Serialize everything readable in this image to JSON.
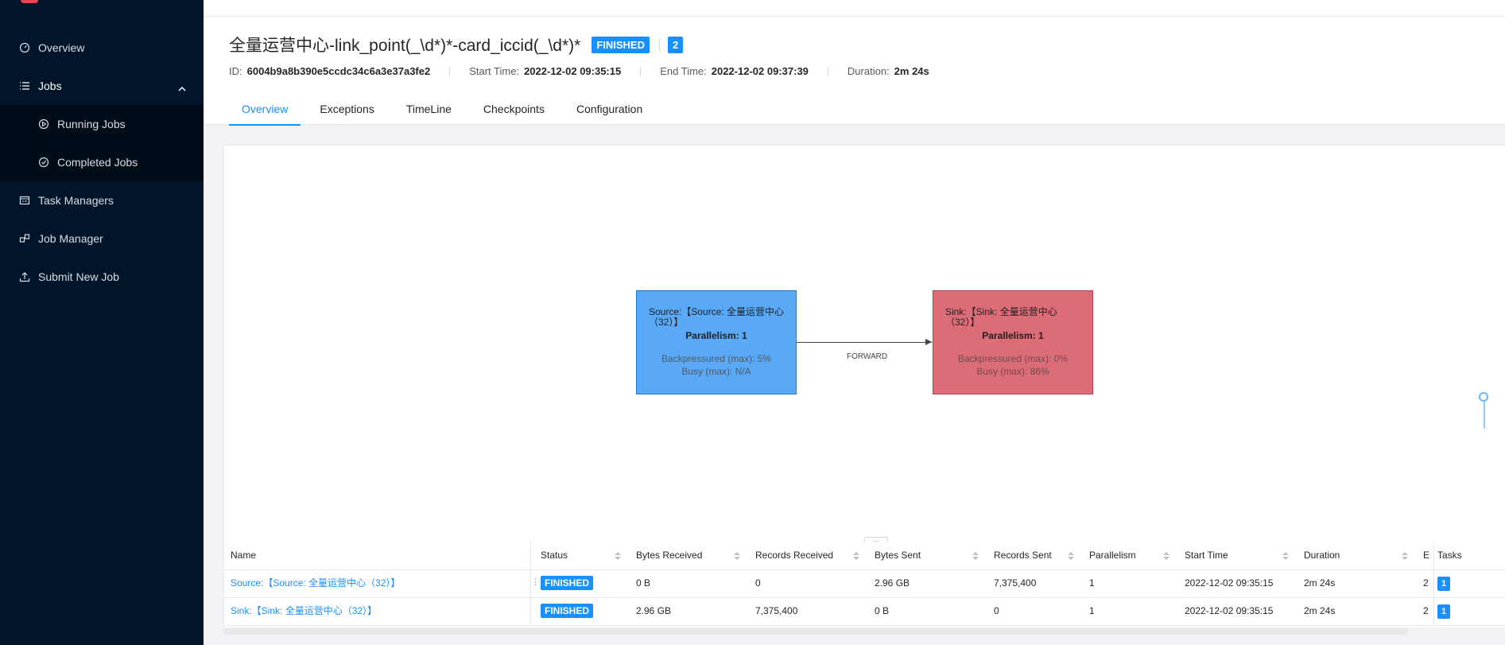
{
  "nav": {
    "items": [
      {
        "label": "Overview"
      },
      {
        "label": "Jobs"
      },
      {
        "label": "Running Jobs"
      },
      {
        "label": "Completed Jobs"
      },
      {
        "label": "Task Managers"
      },
      {
        "label": "Job Manager"
      },
      {
        "label": "Submit New Job"
      }
    ]
  },
  "job": {
    "title": "全量运营中心-link_point(_\\d*)*-card_iccid(_\\d*)*",
    "status": "FINISHED",
    "count": "2",
    "id_label": "ID:",
    "id": "6004b9a8b390e5ccdc34c6a3e37a3fe2",
    "start_label": "Start Time:",
    "start": "2022-12-02 09:35:15",
    "end_label": "End Time:",
    "end": "2022-12-02 09:37:39",
    "duration_label": "Duration:",
    "duration": "2m 24s"
  },
  "tabs": [
    "Overview",
    "Exceptions",
    "TimeLine",
    "Checkpoints",
    "Configuration"
  ],
  "graph": {
    "source": {
      "name": "Source:【Source: 全量运营中心（32）】",
      "parallelism": "Parallelism: 1",
      "backpressure": "Backpressured (max): 5%",
      "busy": "Busy (max): N/A"
    },
    "sink": {
      "name": "Sink:【Sink: 全量运营中心（32）】",
      "parallelism": "Parallelism: 1",
      "backpressure": "Backpressured (max): 0%",
      "busy": "Busy (max): 86%"
    },
    "edge_label": "FORWARD",
    "drag_handle": "..."
  },
  "table": {
    "headers": [
      "Name",
      "Status",
      "Bytes Received",
      "Records Received",
      "Bytes Sent",
      "Records Sent",
      "Parallelism",
      "Start Time",
      "Duration",
      "E",
      "Tasks"
    ],
    "rows": [
      {
        "name": "Source:【Source: 全量运营中心（32）】",
        "status": "FINISHED",
        "bytes_received": "0 B",
        "records_received": "0",
        "bytes_sent": "2.96 GB",
        "records_sent": "7,375,400",
        "parallelism": "1",
        "start_time": "2022-12-02 09:35:15",
        "duration": "2m 24s",
        "end": "2",
        "tasks": "1"
      },
      {
        "name": "Sink:【Sink: 全量运营中心（32）】",
        "status": "FINISHED",
        "bytes_received": "2.96 GB",
        "records_received": "7,375,400",
        "bytes_sent": "0 B",
        "records_sent": "0",
        "parallelism": "1",
        "start_time": "2022-12-02 09:35:15",
        "duration": "2m 24s",
        "end": "2",
        "tasks": "1"
      }
    ]
  },
  "colors": {
    "sidebar_bg": "#001529",
    "accent": "#1890ff",
    "source_node": "#5aa9f7",
    "sink_node": "#dc6c76"
  }
}
